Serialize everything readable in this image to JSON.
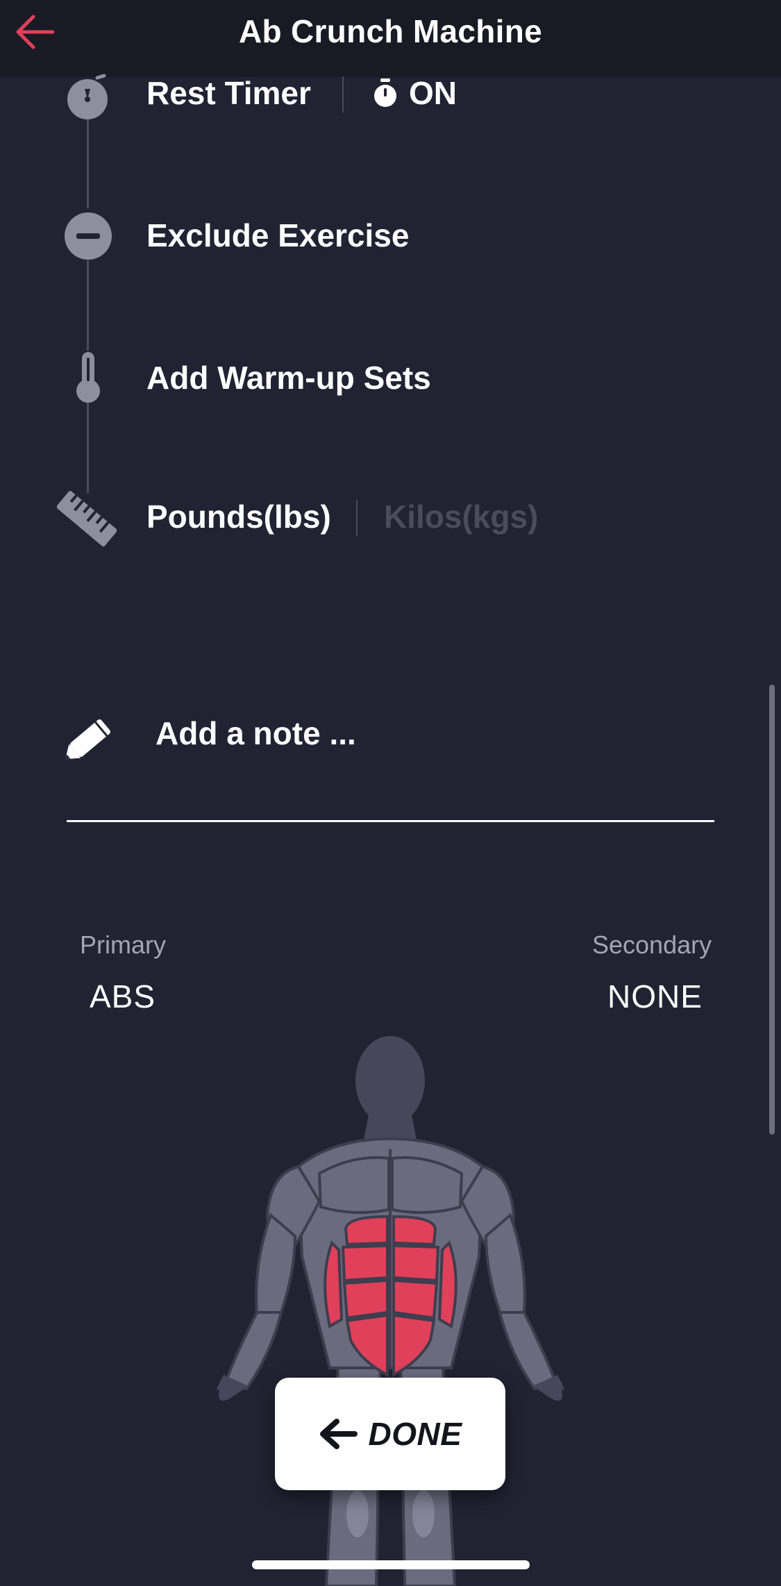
{
  "header": {
    "title": "Ab Crunch Machine",
    "back_icon": "arrow-left-icon",
    "accent_color": "#e0405a"
  },
  "settings": {
    "rest_timer": {
      "label": "Rest Timer",
      "icon": "stopwatch-icon",
      "state_icon": "stopwatch-icon",
      "state": "ON"
    },
    "exclude": {
      "label": "Exclude Exercise",
      "icon": "minus-circle-icon"
    },
    "warmup": {
      "label": "Add Warm-up Sets",
      "icon": "thermometer-icon"
    },
    "units": {
      "icon": "ruler-icon",
      "active": "Pounds(lbs)",
      "inactive": "Kilos(kgs)"
    }
  },
  "note": {
    "icon": "pencil-icon",
    "placeholder": "Add a note ..."
  },
  "muscles": {
    "primary_caption": "Primary",
    "primary_value": "ABS",
    "secondary_caption": "Secondary",
    "secondary_value": "NONE",
    "highlight_color": "#e0405a",
    "body_color": "#6b6b7e"
  },
  "done_button": {
    "icon": "arrow-left-icon",
    "label": "DONE"
  },
  "colors": {
    "background": "#222232",
    "header": "#1a1a24",
    "muted_text": "#a4a4b4"
  }
}
